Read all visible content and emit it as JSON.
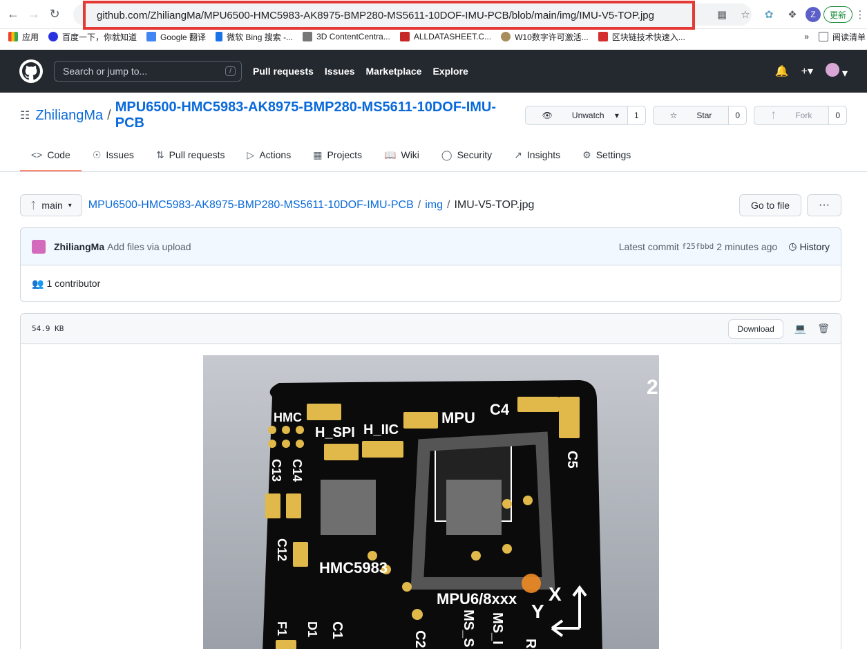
{
  "browser": {
    "url": "github.com/ZhiliangMa/MPU6500-HMC5983-AK8975-BMP280-MS5611-10DOF-IMU-PCB/blob/main/img/IMU-V5-TOP.jpg",
    "profile_initial": "Z",
    "update_label": "更新",
    "bookmarks": [
      "应用",
      "百度一下，你就知道",
      "Google 翻译",
      "微软 Bing 搜索 -...",
      "3D ContentCentra...",
      "ALLDATASHEET.C...",
      "W10数字许可激活...",
      "区块链技术快速入..."
    ],
    "overflow": "»",
    "reading_list": "阅读清单"
  },
  "github": {
    "search_placeholder": "Search or jump to...",
    "search_key": "/",
    "nav": [
      "Pull requests",
      "Issues",
      "Marketplace",
      "Explore"
    ]
  },
  "repo": {
    "owner": "ZhiliangMa",
    "name": "MPU6500-HMC5983-AK8975-BMP280-MS5611-10DOF-IMU-PCB",
    "watch_label": "Unwatch",
    "watch_count": "1",
    "star_label": "Star",
    "star_count": "0",
    "fork_label": "Fork",
    "fork_count": "0",
    "tabs": [
      "Code",
      "Issues",
      "Pull requests",
      "Actions",
      "Projects",
      "Wiki",
      "Security",
      "Insights",
      "Settings"
    ]
  },
  "file": {
    "branch": "main",
    "path_repo": "MPU6500-HMC5983-AK8975-BMP280-MS5611-10DOF-IMU-PCB",
    "path_dir": "img",
    "filename": "IMU-V5-TOP.jpg",
    "goto_label": "Go to file",
    "more": "···",
    "commit_author": "ZhiliangMa",
    "commit_msg": "Add files via upload",
    "latest_commit_label": "Latest commit",
    "commit_sha": "f25fbbd",
    "commit_time": "2 minutes ago",
    "history_label": "History",
    "contributors": "1 contributor",
    "size": "54.9 KB",
    "download_label": "Download"
  },
  "pcb": {
    "labels": [
      "HMC",
      "H_SPI",
      "H_IIC",
      "MPU",
      "C4",
      "C5",
      "C13",
      "C14",
      "C12",
      "HMC5983",
      "MPU6/8xxx",
      "X",
      "Y",
      "F1",
      "D1",
      "C1",
      "C2",
      "MS_S",
      "MS_I",
      "R",
      "2"
    ]
  }
}
